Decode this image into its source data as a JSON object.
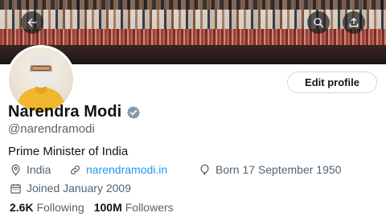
{
  "header": {
    "back_icon": "arrow-left-icon",
    "search_icon": "search-icon",
    "share_icon": "share-icon"
  },
  "profile": {
    "name": "Narendra Modi",
    "handle": "@narendramodi",
    "bio": "Prime Minister of India",
    "location": "India",
    "website": "narendramodi.in",
    "birthday": "Born 17 September 1950",
    "joined": "Joined January 2009",
    "verified_color": "#829aab",
    "link_color": "#1d9bf0"
  },
  "actions": {
    "edit_profile": "Edit profile"
  },
  "stats": {
    "following_count": "2.6K",
    "following_label": "Following",
    "followers_count": "100M",
    "followers_label": "Followers"
  }
}
